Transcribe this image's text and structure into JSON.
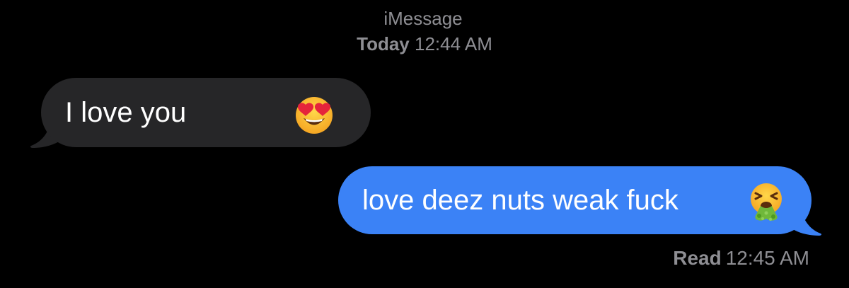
{
  "header": {
    "service": "iMessage",
    "day": "Today",
    "time": "12:44 AM"
  },
  "messages": [
    {
      "direction": "incoming",
      "text": "I love you",
      "emoji": "heart-eyes-icon",
      "bubble_color": "#262628"
    },
    {
      "direction": "outgoing",
      "text": "love deez nuts weak fuck",
      "emoji": "vomiting-face-icon",
      "bubble_color": "#3b82f6"
    }
  ],
  "receipt": {
    "status": "Read",
    "time": "12:45 AM"
  },
  "colors": {
    "background": "#000000",
    "meta_text": "#8e8e93",
    "message_text": "#ffffff"
  }
}
